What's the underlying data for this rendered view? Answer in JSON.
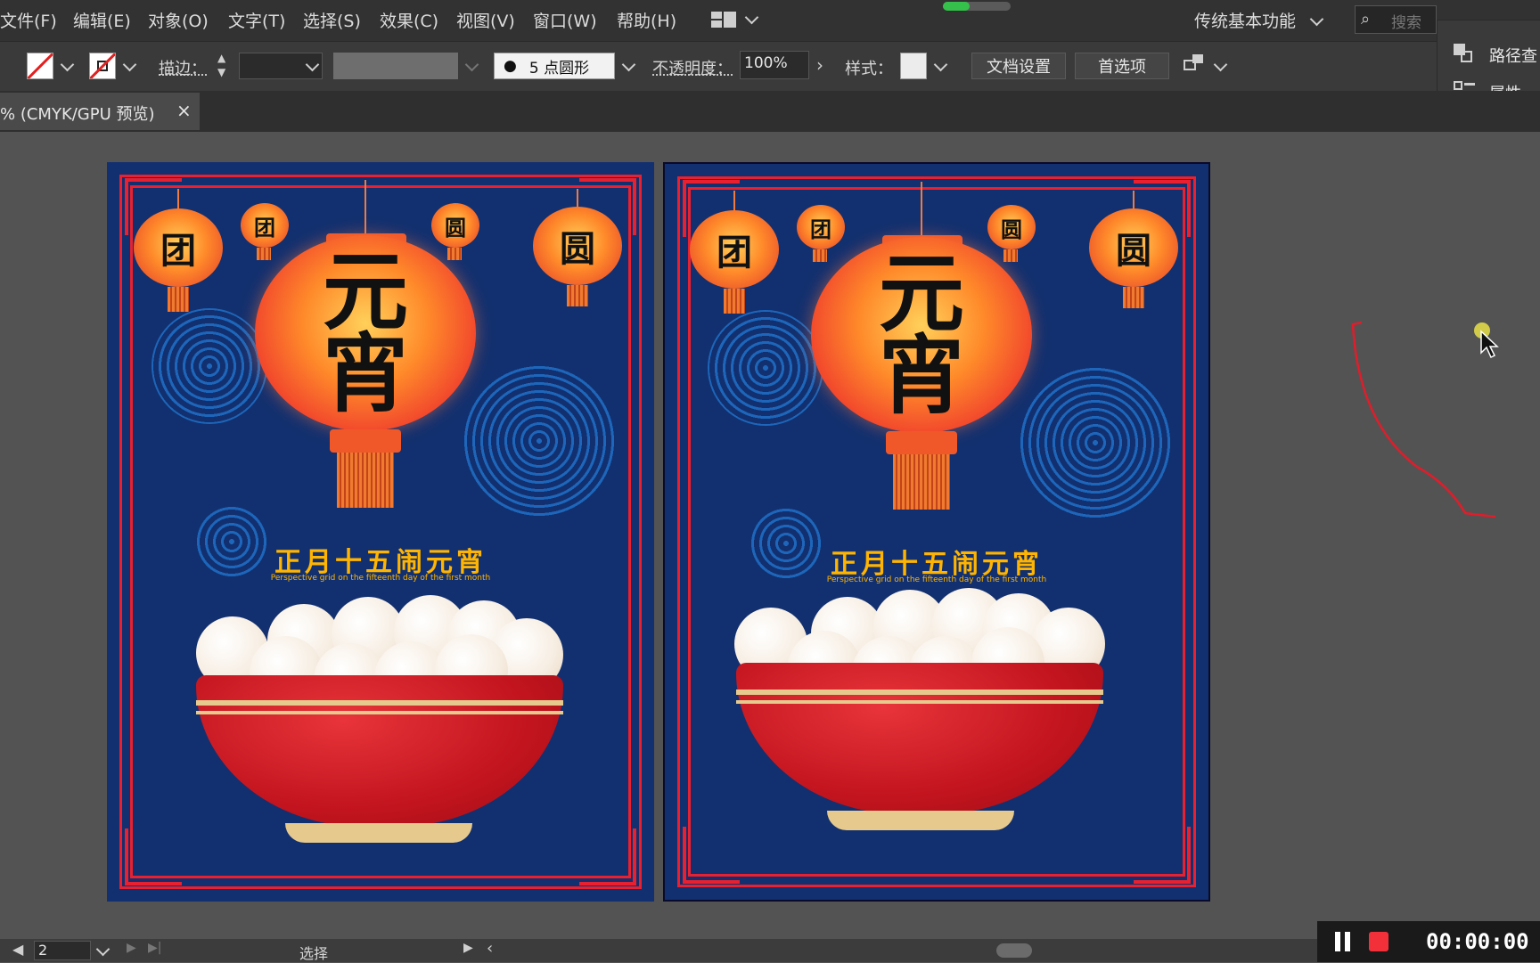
{
  "menu": [
    "文件(F)",
    "编辑(E)",
    "对象(O)",
    "文字(T)",
    "选择(S)",
    "效果(C)",
    "视图(V)",
    "窗口(W)",
    "帮助(H)"
  ],
  "workspace": "传统基本功能",
  "search_placeholder": "搜索",
  "options": {
    "stroke_label": "描边：",
    "brush": "5 点圆形",
    "opacity_label": "不透明度：",
    "opacity_value": "100%",
    "style_label": "样式：",
    "doc_setup": "文档设置",
    "prefs": "首选项"
  },
  "panel": {
    "pathfinder": "路径查",
    "properties": "属性"
  },
  "tab": {
    "title": "% (CMYK/GPU 预览)",
    "close": "×"
  },
  "poster": {
    "big_lantern": [
      "元",
      "宵"
    ],
    "small_lanterns": [
      "团",
      "团",
      "圆",
      "圆"
    ],
    "headline": "正月十五闹元宵",
    "subline": "Perspective grid on the fifteenth day of the first month"
  },
  "status": {
    "page": "2",
    "tool": "选择"
  },
  "recorder": {
    "time": "00:00:00"
  }
}
